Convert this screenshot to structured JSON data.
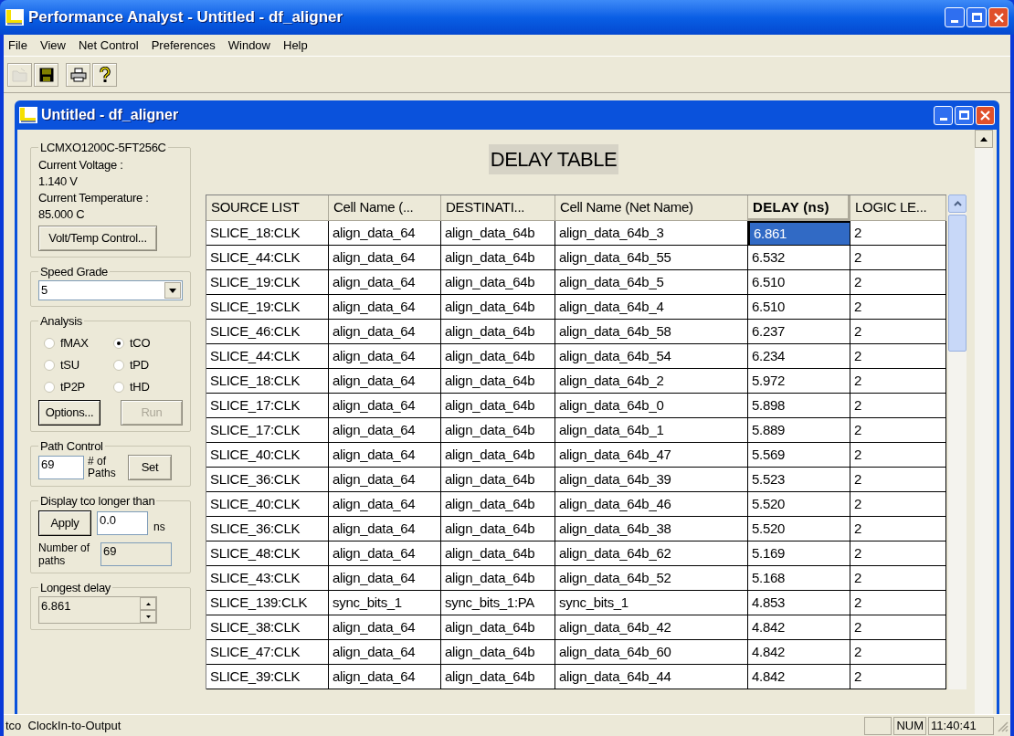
{
  "window": {
    "title": "Performance Analyst - Untitled - df_aligner"
  },
  "menu": [
    "File",
    "View",
    "Net Control",
    "Preferences",
    "Window",
    "Help"
  ],
  "toolbar": [
    {
      "kind": "open",
      "disabled": true
    },
    {
      "kind": "save",
      "disabled": false
    },
    {
      "kind": "print",
      "disabled": false
    },
    {
      "kind": "help",
      "disabled": false
    }
  ],
  "child_window": {
    "title": "Untitled - df_aligner"
  },
  "device": {
    "name": "LCMXO1200C-5FT256C",
    "voltage_label": "Current Voltage :",
    "voltage": "1.140 V",
    "temperature_label": "Current Temperature :",
    "temperature": "85.000 C",
    "button": "Volt/Temp Control..."
  },
  "speed_grade": {
    "label": "Speed Grade",
    "value": "5"
  },
  "analysis": {
    "label": "Analysis",
    "options": [
      {
        "label": "fMAX",
        "selected": false
      },
      {
        "label": "tCO",
        "selected": true
      },
      {
        "label": "tSU",
        "selected": false
      },
      {
        "label": "tPD",
        "selected": false
      },
      {
        "label": "tP2P",
        "selected": false
      },
      {
        "label": "tHD",
        "selected": false
      }
    ],
    "buttons": [
      {
        "label": "Options...",
        "disabled": false
      },
      {
        "label": "Run",
        "disabled": true
      }
    ]
  },
  "path_control": {
    "label": "Path Control",
    "value": "69",
    "caption": "# of Paths",
    "button": "Set"
  },
  "display_filter": {
    "label": "Display tco longer than",
    "button": "Apply",
    "value": "0.0",
    "unit": "ns",
    "count_label": "Number of paths",
    "count": "69"
  },
  "longest_delay": {
    "label": "Longest delay",
    "value": "6.861"
  },
  "table": {
    "title": "DELAY TABLE",
    "columns": [
      {
        "label": "SOURCE LIST",
        "sorted": false
      },
      {
        "label": "Cell Name (...",
        "sorted": false
      },
      {
        "label": "DESTINATI...",
        "sorted": false
      },
      {
        "label": "Cell Name (Net Name)",
        "sorted": false
      },
      {
        "label": "DELAY (ns)",
        "sorted": true
      },
      {
        "label": "LOGIC LE...",
        "sorted": false
      }
    ],
    "rows": [
      {
        "cells": [
          "SLICE_18:CLK",
          "align_data_64",
          "align_data_64b",
          "align_data_64b_3",
          "6.861",
          "2"
        ],
        "selected": true
      },
      {
        "cells": [
          "SLICE_44:CLK",
          "align_data_64",
          "align_data_64b",
          "align_data_64b_55",
          "6.532",
          "2"
        ],
        "selected": false
      },
      {
        "cells": [
          "SLICE_19:CLK",
          "align_data_64",
          "align_data_64b",
          "align_data_64b_5",
          "6.510",
          "2"
        ],
        "selected": false
      },
      {
        "cells": [
          "SLICE_19:CLK",
          "align_data_64",
          "align_data_64b",
          "align_data_64b_4",
          "6.510",
          "2"
        ],
        "selected": false
      },
      {
        "cells": [
          "SLICE_46:CLK",
          "align_data_64",
          "align_data_64b",
          "align_data_64b_58",
          "6.237",
          "2"
        ],
        "selected": false
      },
      {
        "cells": [
          "SLICE_44:CLK",
          "align_data_64",
          "align_data_64b",
          "align_data_64b_54",
          "6.234",
          "2"
        ],
        "selected": false
      },
      {
        "cells": [
          "SLICE_18:CLK",
          "align_data_64",
          "align_data_64b",
          "align_data_64b_2",
          "5.972",
          "2"
        ],
        "selected": false
      },
      {
        "cells": [
          "SLICE_17:CLK",
          "align_data_64",
          "align_data_64b",
          "align_data_64b_0",
          "5.898",
          "2"
        ],
        "selected": false
      },
      {
        "cells": [
          "SLICE_17:CLK",
          "align_data_64",
          "align_data_64b",
          "align_data_64b_1",
          "5.889",
          "2"
        ],
        "selected": false
      },
      {
        "cells": [
          "SLICE_40:CLK",
          "align_data_64",
          "align_data_64b",
          "align_data_64b_47",
          "5.569",
          "2"
        ],
        "selected": false
      },
      {
        "cells": [
          "SLICE_36:CLK",
          "align_data_64",
          "align_data_64b",
          "align_data_64b_39",
          "5.523",
          "2"
        ],
        "selected": false
      },
      {
        "cells": [
          "SLICE_40:CLK",
          "align_data_64",
          "align_data_64b",
          "align_data_64b_46",
          "5.520",
          "2"
        ],
        "selected": false
      },
      {
        "cells": [
          "SLICE_36:CLK",
          "align_data_64",
          "align_data_64b",
          "align_data_64b_38",
          "5.520",
          "2"
        ],
        "selected": false
      },
      {
        "cells": [
          "SLICE_48:CLK",
          "align_data_64",
          "align_data_64b",
          "align_data_64b_62",
          "5.169",
          "2"
        ],
        "selected": false
      },
      {
        "cells": [
          "SLICE_43:CLK",
          "align_data_64",
          "align_data_64b",
          "align_data_64b_52",
          "5.168",
          "2"
        ],
        "selected": false
      },
      {
        "cells": [
          "SLICE_139:CLK",
          "sync_bits_1",
          "sync_bits_1:PA",
          "sync_bits_1",
          "4.853",
          "2"
        ],
        "selected": false
      },
      {
        "cells": [
          "SLICE_38:CLK",
          "align_data_64",
          "align_data_64b",
          "align_data_64b_42",
          "4.842",
          "2"
        ],
        "selected": false
      },
      {
        "cells": [
          "SLICE_47:CLK",
          "align_data_64",
          "align_data_64b",
          "align_data_64b_60",
          "4.842",
          "2"
        ],
        "selected": false
      },
      {
        "cells": [
          "SLICE_39:CLK",
          "align_data_64",
          "align_data_64b",
          "align_data_64b_44",
          "4.842",
          "2"
        ],
        "selected": false
      }
    ]
  },
  "status_bar": {
    "message": "tco  ClockIn-to-Output",
    "indicator": "NUM",
    "time": "11:40:41"
  }
}
